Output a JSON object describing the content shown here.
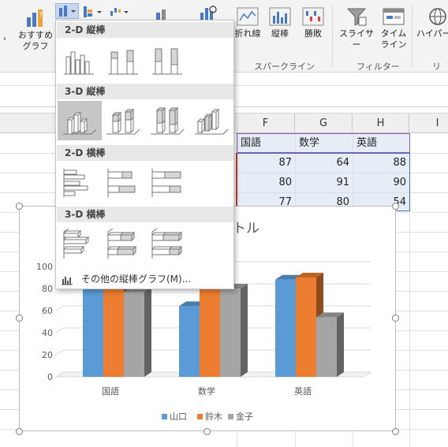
{
  "ribbon": {
    "recommended_label_1": "おすすめ",
    "recommended_label_2": "グラフ",
    "sparkline_line": "折れ線",
    "sparkline_column": "縦棒",
    "sparkline_winloss": "勝敗",
    "sparkline_group": "スパークライン",
    "slicer": "スライサー",
    "timeline_1": "タイム",
    "timeline_2": "ライン",
    "filter_group": "フィルター",
    "hyperlink": "ハイパー",
    "link_group_partial": "リン"
  },
  "columns": [
    "F",
    "G",
    "H",
    "I"
  ],
  "sheet": {
    "headers": [
      "国語",
      "数学",
      "英語"
    ],
    "rows": [
      [
        "87",
        "64",
        "88"
      ],
      [
        "80",
        "91",
        "90"
      ],
      [
        "77",
        "80",
        "54"
      ]
    ]
  },
  "dropdown": {
    "section_2d_column": "2-D 縦棒",
    "section_3d_column": "3-D 縦棒",
    "section_2d_bar": "2-D 横棒",
    "section_3d_bar": "3-D 横棒",
    "more_label": "その他の縦棒グラフ(M)..."
  },
  "chart_data": {
    "type": "bar",
    "title": "トル",
    "categories": [
      "国語",
      "数学",
      "英語"
    ],
    "series": [
      {
        "name": "山口",
        "values": [
          87,
          64,
          88
        ]
      },
      {
        "name": "鈴木",
        "values": [
          80,
          91,
          90
        ]
      },
      {
        "name": "金子",
        "values": [
          77,
          80,
          54
        ]
      }
    ],
    "yticks": [
      "0",
      "20",
      "40",
      "60",
      "80",
      "100"
    ],
    "ylim": [
      0,
      100
    ],
    "colors": [
      "#5b9bd5",
      "#ed7d31",
      "#a5a5a5"
    ],
    "legend": "bottom",
    "style": "3d-clustered-column"
  }
}
